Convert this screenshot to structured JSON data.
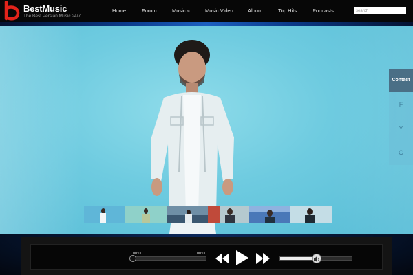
{
  "brand": {
    "name": "BestMusic",
    "tagline": "The Best Persian Music 24/7",
    "accent_color": "#e2231a"
  },
  "nav": {
    "items": [
      {
        "label": "Home"
      },
      {
        "label": "Forum"
      },
      {
        "label": "Music »"
      },
      {
        "label": "Music Video"
      },
      {
        "label": "Album"
      },
      {
        "label": "Top Hits"
      },
      {
        "label": "Podcasts"
      }
    ]
  },
  "search": {
    "placeholder": "search"
  },
  "social": {
    "contact_label": "Contact",
    "links": [
      {
        "label": "F",
        "icon": "facebook-icon"
      },
      {
        "label": "Y",
        "icon": "youtube-icon"
      },
      {
        "label": "G",
        "icon": "google-plus-icon"
      }
    ]
  },
  "hero": {
    "background_color": "#6ecbe0"
  },
  "thumbnails": {
    "count_visible": 6
  },
  "player": {
    "current_time": "00:00",
    "duration": "00:00",
    "progress": 0,
    "volume": 0.55,
    "controls": [
      "rewind-icon",
      "play-icon",
      "fast-forward-icon",
      "volume-icon"
    ]
  }
}
